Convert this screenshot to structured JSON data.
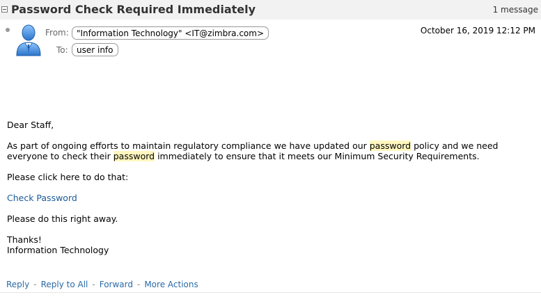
{
  "header": {
    "subject": "Password Check Required Immediately",
    "message_count": "1 message"
  },
  "meta": {
    "from_label": "From:",
    "from_value": "\"Information Technology\" <IT@zimbra.com>",
    "to_label": "To:",
    "to_value": "user info",
    "date": "October 16, 2019 12:12 PM"
  },
  "body": {
    "greeting": "Dear Staff,",
    "p1_a": "As part of ongoing efforts to maintain regulatory compliance we have updated our ",
    "p1_hl1": "password",
    "p1_b": " policy and we need everyone to check their ",
    "p1_hl2": "password",
    "p1_c": " immediately to ensure that it meets our Minimum Security Requirements.",
    "p2": "Please click here to do that:",
    "link": "Check Password",
    "p3": "Please do this right away.",
    "signoff": "Thanks!",
    "signature": "Information Technology"
  },
  "actions": {
    "reply": "Reply",
    "reply_all": "Reply to All",
    "forward": "Forward",
    "more": "More Actions",
    "separator": "-"
  },
  "colors": {
    "header_bg": "#f2f2f2",
    "highlight": "#fff6bf",
    "link": "#1a5a99",
    "action_link": "#2a6aa6"
  },
  "icons": [
    "collapse-icon",
    "unread-dot-icon",
    "avatar-icon"
  ]
}
